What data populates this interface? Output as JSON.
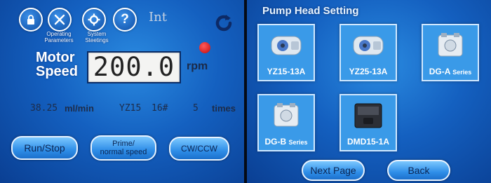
{
  "left_panel": {
    "icons": [
      {
        "name": "lock-icon",
        "glyph": "🔒"
      },
      {
        "name": "operating-parameters-icon",
        "glyph": "✂"
      },
      {
        "name": "system-settings-icon",
        "glyph": "⚙"
      },
      {
        "name": "help-icon",
        "glyph": "?"
      }
    ],
    "operating_parameters_line1": "Operating",
    "operating_parameters_line2": "Parameters",
    "system_settings_line1": "System",
    "system_settings_line2": "Steetings",
    "int_label": "Int",
    "motor_label_line1": "Motor",
    "motor_label_line2": "Speed",
    "speed_value": "200.0",
    "speed_unit": "rpm",
    "flow_value": "38.25",
    "flow_unit": "ml/min",
    "pump_model": "YZ15",
    "tube_size": "16#",
    "times_value": "5",
    "times_label": "times",
    "run_stop_label": "Run/Stop",
    "prime_line1": "Prime/",
    "prime_line2": "normal speed",
    "cw_ccw_label": "CW/CCW",
    "colors": {
      "accent": "#1460c0",
      "indicator": "#e01a1a"
    }
  },
  "right_panel": {
    "title": "Pump Head Setting",
    "tiles": [
      {
        "label": "YZ15-13A",
        "suffix": ""
      },
      {
        "label": "YZ25-13A",
        "suffix": ""
      },
      {
        "label": "DG-A",
        "suffix": "Series"
      },
      {
        "label": "DG-B",
        "suffix": "Series"
      },
      {
        "label": "DMD15-1A",
        "suffix": ""
      }
    ],
    "next_page_label": "Next Page",
    "back_label": "Back"
  }
}
